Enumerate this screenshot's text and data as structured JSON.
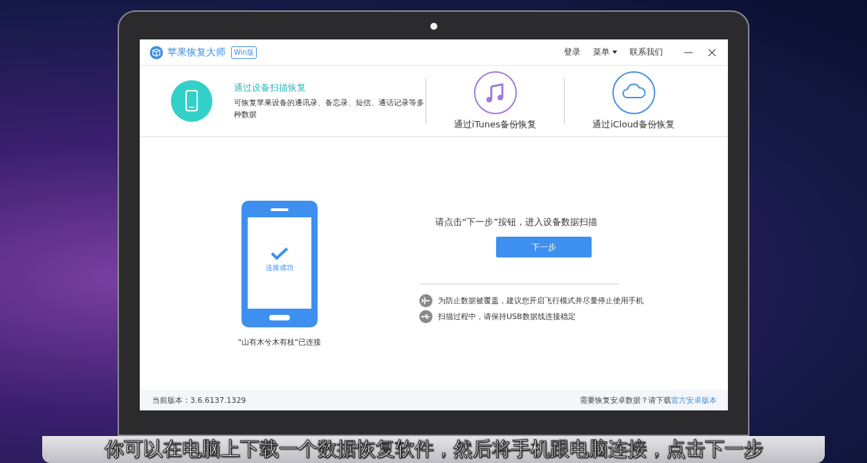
{
  "window": {
    "title": "苹果恢复大师",
    "badge": "Win版",
    "menu": [
      {
        "label": "登录",
        "kind": "link"
      },
      {
        "label": "菜单",
        "kind": "dropdown"
      },
      {
        "label": "联系我们",
        "kind": "link"
      }
    ]
  },
  "modes": [
    {
      "kind": "device",
      "title": "通过设备扫描恢复",
      "description": "可恢复苹果设备的通讯录、备忘录、短信、通话记录等多种数据",
      "selected": true
    },
    {
      "kind": "itunes",
      "title": "通过iTunes备份恢复",
      "selected": false
    },
    {
      "kind": "icloud",
      "title": "通过iCloud备份恢复",
      "selected": false
    }
  ],
  "device": {
    "status": "连接成功",
    "caption": "\"山有木兮木有枝\"已连接"
  },
  "prompt": "请点击“下一步”按钮，进入设备数据扫描",
  "next_button": "下一步",
  "tips": [
    {
      "kind": "airplane",
      "text": "为防止数据被覆盖，建议您开启飞行模式并尽量停止使用手机"
    },
    {
      "kind": "usb",
      "text": "扫描过程中，请保持USB数据线连接稳定"
    }
  ],
  "footer": {
    "version": "当前版本：3.6.6137.1329",
    "android_prompt": "需要恢复安卓数据？请下载",
    "android_link": "官方安卓版本"
  },
  "subtitle": "你可以在电脑上下载一个数据恢复软件，然后将手机跟电脑连接，点击下一步"
}
